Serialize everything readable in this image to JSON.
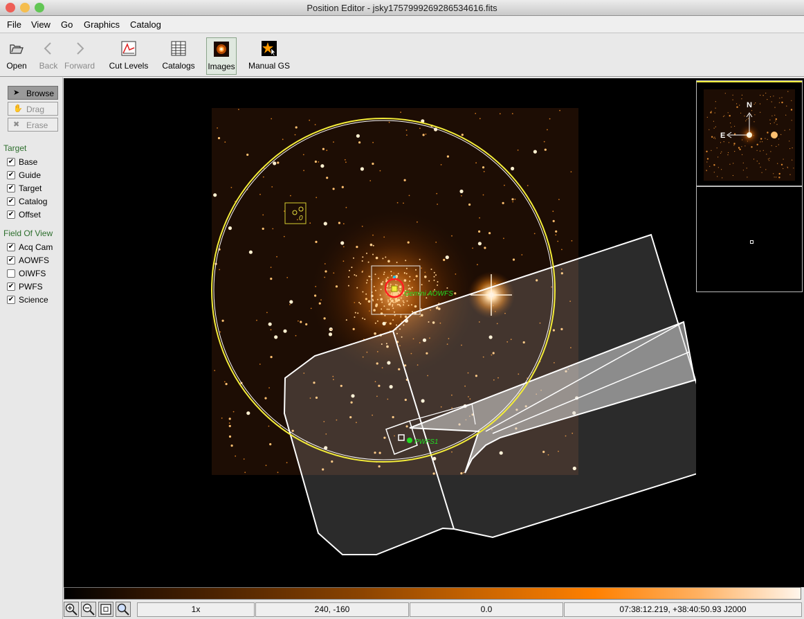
{
  "window": {
    "title": "Position Editor - jsky1757999269286534616.fits",
    "close_color": "#ee5f57",
    "minimize_color": "#f5be4f",
    "maximize_color": "#62c655"
  },
  "menu": [
    "File",
    "View",
    "Go",
    "Graphics",
    "Catalog"
  ],
  "toolbar": [
    {
      "label": "Open",
      "icon": "folder-open-icon",
      "enabled": true,
      "selected": false
    },
    {
      "label": "Back",
      "icon": "chevron-left-icon",
      "enabled": false,
      "selected": false
    },
    {
      "label": "Forward",
      "icon": "chevron-right-icon",
      "enabled": false,
      "selected": false
    },
    {
      "label": "Cut Levels",
      "icon": "cut-levels-icon",
      "enabled": true,
      "selected": false
    },
    {
      "label": "Catalogs",
      "icon": "catalog-table-icon",
      "enabled": true,
      "selected": false
    },
    {
      "label": "Images",
      "icon": "image-star-icon",
      "enabled": true,
      "selected": true
    },
    {
      "label": "Manual GS",
      "icon": "manual-guide-star-icon",
      "enabled": true,
      "selected": false
    }
  ],
  "modes": [
    {
      "label": "Browse",
      "icon": "arrow-pointer-icon",
      "active": true,
      "enabled": true
    },
    {
      "label": "Drag",
      "icon": "hand-icon",
      "active": false,
      "enabled": false
    },
    {
      "label": "Erase",
      "icon": "eraser-x-icon",
      "active": false,
      "enabled": false
    }
  ],
  "target_section": {
    "title": "Target",
    "items": [
      {
        "label": "Base",
        "checked": true
      },
      {
        "label": "Guide",
        "checked": true
      },
      {
        "label": "Target",
        "checked": true
      },
      {
        "label": "Catalog",
        "checked": true
      },
      {
        "label": "Offset",
        "checked": true
      }
    ]
  },
  "fov_section": {
    "title": "Field Of View",
    "items": [
      {
        "label": "Acq Cam",
        "checked": true
      },
      {
        "label": "AOWFS",
        "checked": true
      },
      {
        "label": "OIWFS",
        "checked": false
      },
      {
        "label": "PWFS",
        "checked": true
      },
      {
        "label": "Science",
        "checked": true
      }
    ]
  },
  "image": {
    "aowfs_label": "Gemini AOWFS",
    "pwfs_label": "PWFS1",
    "offset_label": "0",
    "highlight_color": "#f3ec3a",
    "guide_color": "#22dd22",
    "science_color": "#ff2020"
  },
  "panner": {
    "north_label": "N",
    "east_label": "E"
  },
  "status": {
    "zoom": "1x",
    "pixel": "240, -160",
    "value": "0.0",
    "coords": "07:38:12.219, +38:40:50.93 J2000"
  },
  "zoom_buttons": [
    "zoom-in-icon",
    "zoom-out-icon",
    "zoom-fit-icon",
    "zoom-magnify-icon"
  ]
}
